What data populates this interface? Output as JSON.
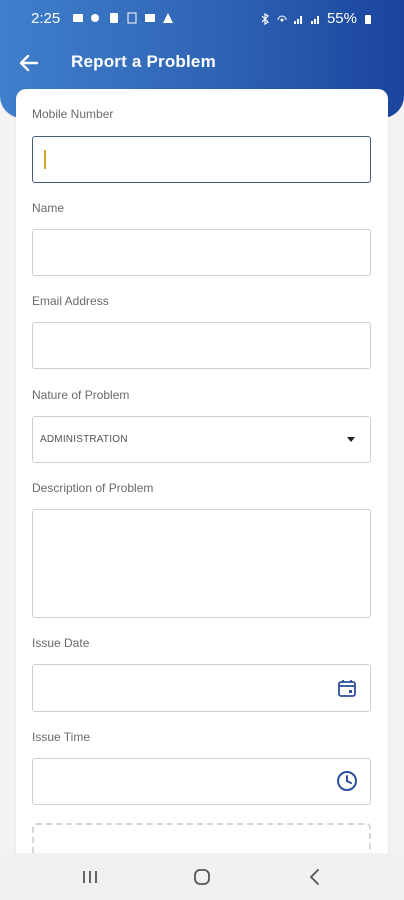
{
  "status_bar": {
    "time": "2:25",
    "battery": "55%"
  },
  "app_bar": {
    "title": "Report a Problem",
    "back_icon": "arrow-left-icon"
  },
  "form": {
    "mobile_number": {
      "label": "Mobile Number",
      "value": ""
    },
    "name": {
      "label": "Name",
      "value": ""
    },
    "email": {
      "label": "Email Address",
      "value": ""
    },
    "nature": {
      "label": "Nature of Problem",
      "selected": "ADMINISTRATION",
      "icon": "caret-down-icon"
    },
    "description": {
      "label": "Description of Problem",
      "value": ""
    },
    "issue_date": {
      "label": "Issue Date",
      "value": "",
      "icon": "calendar-icon"
    },
    "issue_time": {
      "label": "Issue Time",
      "value": "",
      "icon": "clock-icon"
    }
  },
  "colors": {
    "header_start": "#3f7fcc",
    "header_end": "#1a449e",
    "accent_icon": "#2d4e9c",
    "cursor": "#d9a431"
  },
  "nav": {
    "recents_icon": "recents-icon",
    "home_icon": "home-icon",
    "back_icon": "back-chevron-icon"
  }
}
